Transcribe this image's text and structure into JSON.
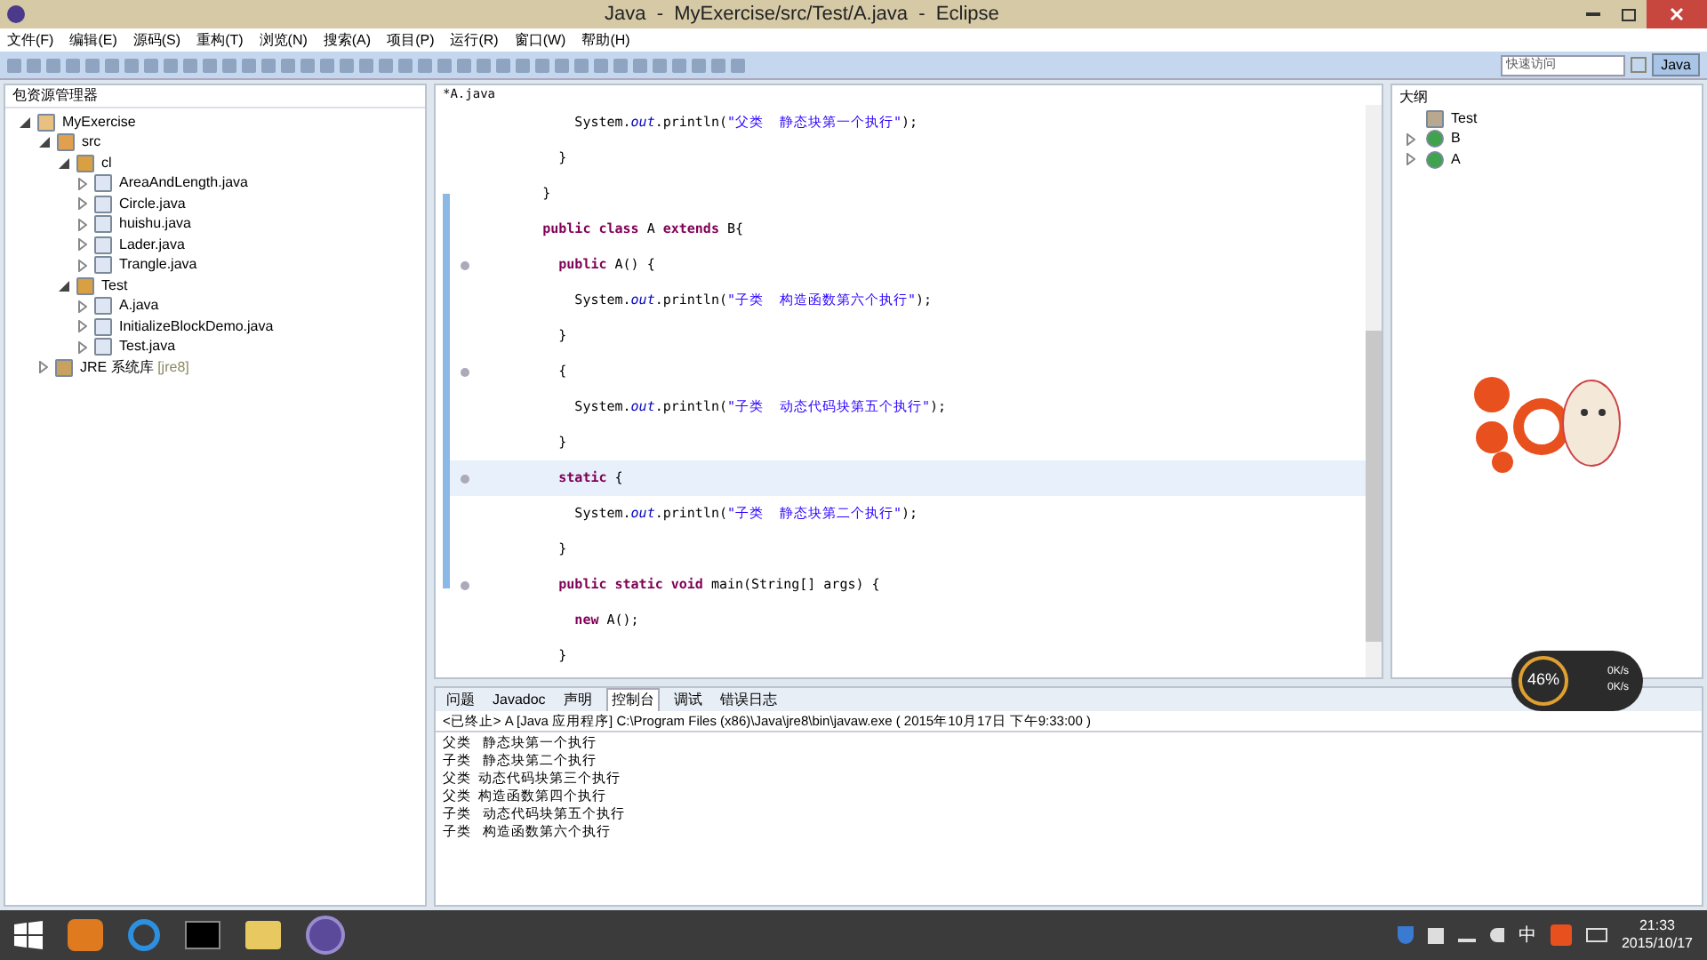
{
  "window": {
    "title": "Java  -  MyExercise/src/Test/A.java  -  Eclipse"
  },
  "menu": [
    "文件(F)",
    "编辑(E)",
    "源码(S)",
    "重构(T)",
    "浏览(N)",
    "搜索(A)",
    "项目(P)",
    "运行(R)",
    "窗口(W)",
    "帮助(H)"
  ],
  "toolbar": {
    "quick_access": {
      "placeholder": "快速访问"
    },
    "perspective": {
      "label": "Java",
      "selected": true
    }
  },
  "package_explorer": {
    "title": "包资源管理器",
    "tree": [
      {
        "label": "MyExercise",
        "kind": "project",
        "expanded": true,
        "children": [
          {
            "label": "src",
            "kind": "folder",
            "expanded": true,
            "children": [
              {
                "label": "cl",
                "kind": "package",
                "expanded": true,
                "children": [
                  {
                    "label": "AreaAndLength.java",
                    "kind": "file",
                    "expanded": false
                  },
                  {
                    "label": "Circle.java",
                    "kind": "file",
                    "expanded": false
                  },
                  {
                    "label": "huishu.java",
                    "kind": "file",
                    "expanded": false
                  },
                  {
                    "label": "Lader.java",
                    "kind": "file",
                    "expanded": false
                  },
                  {
                    "label": "Trangle.java",
                    "kind": "file",
                    "expanded": false
                  }
                ]
              },
              {
                "label": "Test",
                "kind": "package",
                "expanded": true,
                "children": [
                  {
                    "label": "A.java",
                    "kind": "file",
                    "expanded": false
                  },
                  {
                    "label": "InitializeBlockDemo.java",
                    "kind": "file",
                    "expanded": false
                  },
                  {
                    "label": "Test.java",
                    "kind": "file",
                    "expanded": false
                  }
                ]
              }
            ]
          },
          {
            "label": "JRE 系统库",
            "suffix": "[jre8]",
            "kind": "library",
            "expanded": false
          }
        ]
      }
    ]
  },
  "editor": {
    "tab": "*A.java",
    "lines": [
      {
        "fold": false,
        "current": false,
        "tokens": [
          {
            "kind": "text",
            "text": "            System."
          },
          {
            "kind": "field",
            "text": "out"
          },
          {
            "kind": "text",
            "text": ".println("
          },
          {
            "kind": "string",
            "text": "\"父类  静态块第一个执行\""
          },
          {
            "kind": "text",
            "text": ");"
          }
        ]
      },
      {
        "fold": false,
        "current": false,
        "tokens": [
          {
            "kind": "text",
            "text": "          }"
          }
        ]
      },
      {
        "fold": false,
        "current": false,
        "tokens": [
          {
            "kind": "text",
            "text": "        }"
          }
        ]
      },
      {
        "fold": false,
        "current": false,
        "tokens": [
          {
            "kind": "keyword",
            "text": "        public class"
          },
          {
            "kind": "text",
            "text": " A "
          },
          {
            "kind": "keyword",
            "text": "extends"
          },
          {
            "kind": "text",
            "text": " B{"
          }
        ]
      },
      {
        "fold": true,
        "current": false,
        "tokens": [
          {
            "kind": "keyword",
            "text": "          public"
          },
          {
            "kind": "text",
            "text": " A() {"
          }
        ]
      },
      {
        "fold": false,
        "current": false,
        "tokens": [
          {
            "kind": "text",
            "text": "            System."
          },
          {
            "kind": "field",
            "text": "out"
          },
          {
            "kind": "text",
            "text": ".println("
          },
          {
            "kind": "string",
            "text": "\"子类  构造函数第六个执行\""
          },
          {
            "kind": "text",
            "text": ");"
          }
        ]
      },
      {
        "fold": false,
        "current": false,
        "tokens": [
          {
            "kind": "text",
            "text": "          }"
          }
        ]
      },
      {
        "fold": true,
        "current": false,
        "tokens": [
          {
            "kind": "text",
            "text": "          {"
          }
        ]
      },
      {
        "fold": false,
        "current": false,
        "tokens": [
          {
            "kind": "text",
            "text": "            System."
          },
          {
            "kind": "field",
            "text": "out"
          },
          {
            "kind": "text",
            "text": ".println("
          },
          {
            "kind": "string",
            "text": "\"子类  动态代码块第五个执行\""
          },
          {
            "kind": "text",
            "text": ");"
          }
        ]
      },
      {
        "fold": false,
        "current": false,
        "tokens": [
          {
            "kind": "text",
            "text": "          }"
          }
        ]
      },
      {
        "fold": true,
        "current": true,
        "tokens": [
          {
            "kind": "keyword",
            "text": "          static"
          },
          {
            "kind": "text",
            "text": " {"
          }
        ]
      },
      {
        "fold": false,
        "current": false,
        "tokens": [
          {
            "kind": "text",
            "text": "            System."
          },
          {
            "kind": "field",
            "text": "out"
          },
          {
            "kind": "text",
            "text": ".println("
          },
          {
            "kind": "string",
            "text": "\"子类  静态块第二个执行\""
          },
          {
            "kind": "text",
            "text": ");"
          }
        ]
      },
      {
        "fold": false,
        "current": false,
        "tokens": [
          {
            "kind": "text",
            "text": "          }"
          }
        ]
      },
      {
        "fold": true,
        "current": false,
        "tokens": [
          {
            "kind": "keyword",
            "text": "          public static void"
          },
          {
            "kind": "text",
            "text": " main(String[] args) {"
          }
        ]
      },
      {
        "fold": false,
        "current": false,
        "tokens": [
          {
            "kind": "keyword",
            "text": "            new"
          },
          {
            "kind": "text",
            "text": " A();"
          }
        ]
      },
      {
        "fold": false,
        "current": false,
        "tokens": [
          {
            "kind": "text",
            "text": "          }"
          }
        ]
      }
    ]
  },
  "outline": {
    "title": "大纲",
    "items": [
      {
        "label": "Test",
        "kind": "import"
      },
      {
        "label": "B",
        "kind": "class",
        "expanded": false
      },
      {
        "label": "A",
        "kind": "class",
        "expanded": false
      }
    ]
  },
  "bottom_tabs": [
    {
      "label": "问题",
      "selected": false
    },
    {
      "label": "Javadoc",
      "selected": false
    },
    {
      "label": "声明",
      "selected": false
    },
    {
      "label": "控制台",
      "selected": true
    },
    {
      "label": "调试",
      "selected": false
    },
    {
      "label": "错误日志",
      "selected": false
    }
  ],
  "console": {
    "header": "<已终止> A [Java 应用程序] C:\\Program Files (x86)\\Java\\jre8\\bin\\javaw.exe ( 2015年10月17日 下午9:33:00 )",
    "lines": [
      "父类   静态块第一个执行",
      "子类   静态块第二个执行",
      "父类  动态代码块第三个执行",
      "父类  构造函数第四个执行",
      "子类   动态代码块第五个执行",
      "子类   构造函数第六个执行"
    ]
  },
  "speed_widget": {
    "percent": "46%",
    "up": "0K/s",
    "down": "0K/s"
  },
  "taskbar": {
    "time": "21:33",
    "date": "2015/10/17",
    "ime": "中"
  }
}
